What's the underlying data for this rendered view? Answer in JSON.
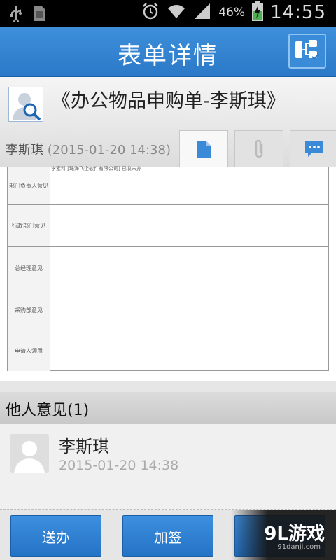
{
  "status_bar": {
    "battery": "46%",
    "time": "14:55"
  },
  "titlebar": {
    "title": "表单详情"
  },
  "header": {
    "form_title": "《办公物品申购单-李斯琪》",
    "submitter": "李斯琪",
    "submitted_at": "(2015-01-20 14:38)"
  },
  "document": {
    "rows": [
      {
        "label": "部门负责人意见",
        "note": "李素科 [珠海飞企软件有限公司] 已收未办"
      },
      {
        "label": "行政部门意见",
        "note": ""
      },
      {
        "label": "总经理意见",
        "note": ""
      },
      {
        "label": "采购部意见",
        "note": ""
      },
      {
        "label": "申请人领用",
        "note": ""
      }
    ]
  },
  "opinions": {
    "header": "他人意见(1)",
    "items": [
      {
        "name": "李斯琪",
        "time": "2015-01-20 14:38"
      }
    ]
  },
  "actions": {
    "send": "送办",
    "countersign": "加签"
  },
  "watermark": {
    "main": "9L游戏",
    "sub": "91danji.com"
  }
}
